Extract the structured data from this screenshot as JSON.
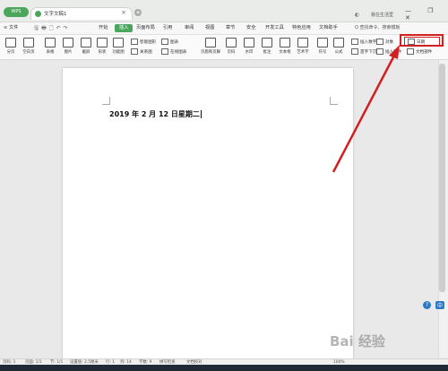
{
  "titlebar": {
    "wps_label": "WPS",
    "doc_tab_title": "文字文稿1",
    "user": "我在生活里",
    "close_glyph": "×",
    "plus_glyph": "+",
    "window_buttons": "— ❐ ✕"
  },
  "menubar": {
    "file": "≡ 文件",
    "quick": "🖫🖶🗋↶↷",
    "items": [
      "开始",
      "插入",
      "页面布局",
      "引用",
      "审阅",
      "视图",
      "章节",
      "安全",
      "开发工具",
      "特色应用",
      "文档助手"
    ],
    "search": "Q 查找命令、搜索模板"
  },
  "ribbon": {
    "big_buttons": [
      "分页",
      "空白页",
      "表格",
      "图片",
      "截屏",
      "形状",
      "功能图",
      "稻壳资源",
      "图表",
      "页眉和页脚",
      "页码",
      "水印",
      "批注",
      "文本框",
      "艺术字",
      "符号",
      "公式",
      "首字下沉",
      "插入附件"
    ],
    "small": {
      "smart_shape": "智能图形",
      "chart": "图表",
      "relation": "关系图",
      "online_chart": "在线图表",
      "insert_number": "插入数字",
      "object": "对象",
      "date": "日期",
      "doc_parts": "文档部件"
    }
  },
  "document": {
    "text": "2019 年 2 月 12 日星期二"
  },
  "side": {
    "ime": "中",
    "help": "?"
  },
  "statusbar": {
    "page": "页码: 1",
    "pages": "页面: 1/1",
    "section": "节: 1/1",
    "position": "设置值: 2.5厘米",
    "row": "行: 1",
    "col": "列: 14",
    "words": "字数: 9",
    "spell": "拼写检查",
    "proof": "文档校对",
    "zoom": "100%"
  },
  "watermark": "Bai 经验",
  "colors": {
    "accent": "#4aa65a",
    "highlight": "#d21f1f",
    "taskbar": "#1f2a36"
  }
}
